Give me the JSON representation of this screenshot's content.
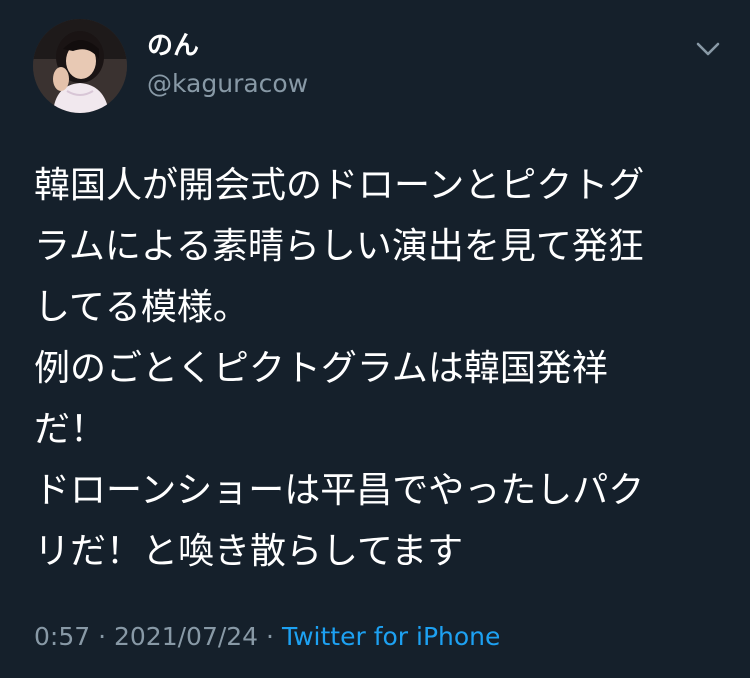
{
  "user": {
    "display_name": "のん",
    "handle": "@kaguracow"
  },
  "tweet": {
    "lines": [
      "韓国人が開会式のドローンとピクトグ",
      "ラムによる素晴らしい演出を見て発狂",
      "してる模様。",
      "例のごとくピクトグラムは韓国発祥",
      "だ！",
      "ドローンショーは平昌でやったしパク",
      "リだ！と喚き散らしてます"
    ],
    "time": "0:57",
    "separator": "·",
    "date": "2021/07/24",
    "source": "Twitter for iPhone"
  },
  "icons": {
    "menu": "chevron-down-icon"
  },
  "colors": {
    "background": "#15202b",
    "text": "#ffffff",
    "secondary": "#8899a6",
    "link": "#1da1f2"
  }
}
